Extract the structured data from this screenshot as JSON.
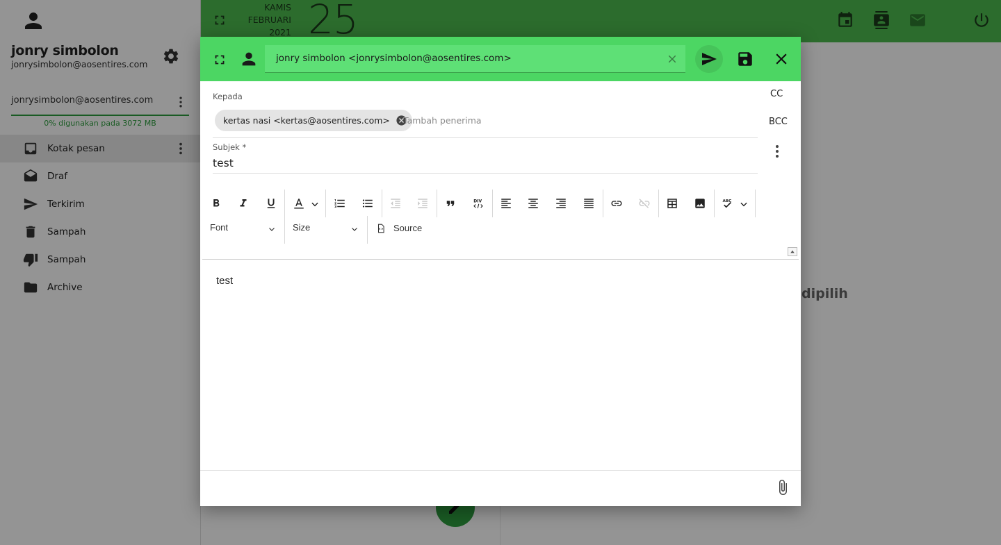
{
  "sidebar": {
    "user_name": "jonry simbolon",
    "user_email": "jonrysimbolon@aosentires.com",
    "account_email": "jonrysimbolon@aosentires.com",
    "quota_text": "0% digunakan pada 3072 MB",
    "folders": [
      {
        "label": "Kotak pesan",
        "icon": "inbox-icon",
        "active": true
      },
      {
        "label": "Draf",
        "icon": "drafts-icon",
        "active": false
      },
      {
        "label": "Terkirim",
        "icon": "send-icon",
        "active": false
      },
      {
        "label": "Sampah",
        "icon": "trash-icon",
        "active": false
      },
      {
        "label": "Sampah",
        "icon": "thumb-down-icon",
        "active": false
      },
      {
        "label": "Archive",
        "icon": "folder-icon",
        "active": false
      }
    ]
  },
  "topbar": {
    "weekday": "KAMIS",
    "month": "FEBRUARI",
    "year": "2021",
    "day": "25",
    "icons": [
      "calendar-icon",
      "contacts-icon",
      "mail-icon",
      "power-icon"
    ],
    "accent_color": "#4cbb4f"
  },
  "main": {
    "no_selection_text": "dipilih"
  },
  "compose": {
    "header_color": "#4cd663",
    "from_value": "jonry simbolon <jonrysimbolon@aosentires.com>",
    "to_label": "Kepada",
    "recipients": [
      "kertas nasi <kertas@aosentires.com>"
    ],
    "add_recipient_placeholder": "Tambah penerima",
    "cc_label": "CC",
    "bcc_label": "BCC",
    "subject_label": "Subjek *",
    "subject_value": "test",
    "toolbar": {
      "font_label": "Font",
      "size_label": "Size",
      "source_label": "Source"
    },
    "body_text": "test"
  }
}
